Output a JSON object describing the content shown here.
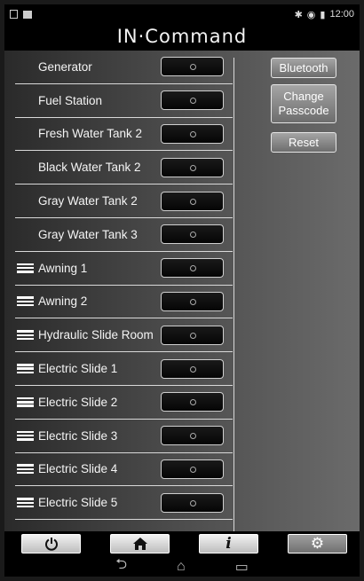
{
  "status": {
    "time": "12:00"
  },
  "logo": "IN·Command",
  "list": [
    {
      "label": "Generator",
      "handle": false
    },
    {
      "label": "Fuel Station",
      "handle": false
    },
    {
      "label": "Fresh Water Tank 2",
      "handle": false
    },
    {
      "label": "Black Water Tank 2",
      "handle": false
    },
    {
      "label": "Gray Water Tank 2",
      "handle": false
    },
    {
      "label": "Gray Water Tank 3",
      "handle": false
    },
    {
      "label": "Awning 1",
      "handle": true
    },
    {
      "label": "Awning 2",
      "handle": true
    },
    {
      "label": "Hydraulic Slide Room",
      "handle": true
    },
    {
      "label": "Electric Slide 1",
      "handle": true
    },
    {
      "label": "Electric Slide 2",
      "handle": true
    },
    {
      "label": "Electric Slide 3",
      "handle": true
    },
    {
      "label": "Electric Slide 4",
      "handle": true
    },
    {
      "label": "Electric Slide 5",
      "handle": true
    }
  ],
  "side_buttons": {
    "bluetooth": "Bluetooth",
    "change_passcode_1": "Change",
    "change_passcode_2": "Passcode",
    "reset": "Reset"
  },
  "tabs": [
    {
      "icon": "power-icon",
      "active": false
    },
    {
      "icon": "home-icon",
      "active": false
    },
    {
      "icon": "info-icon",
      "active": false
    },
    {
      "icon": "gear-icon",
      "active": true
    }
  ],
  "nav": [
    "back-icon",
    "home-nav-icon",
    "recents-icon"
  ]
}
